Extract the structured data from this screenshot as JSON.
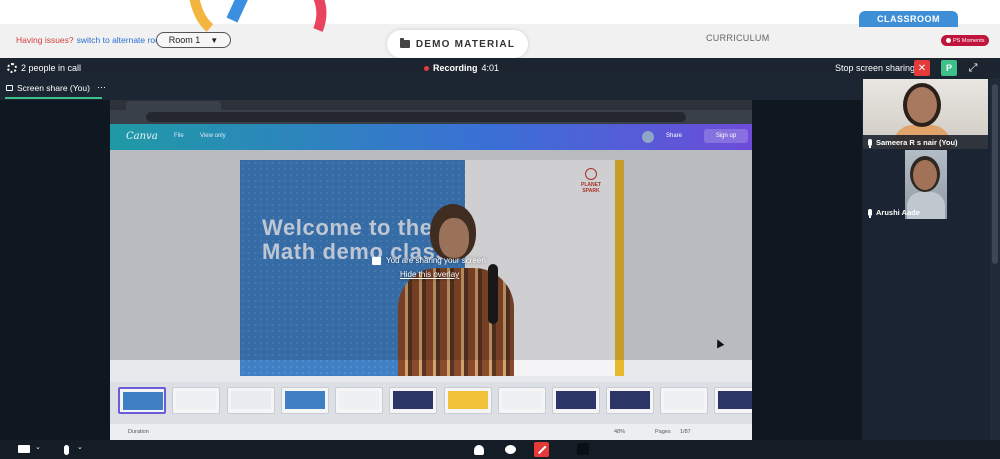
{
  "top": {
    "issue_text": "Having issues?",
    "issue_link": "switch to alternate room",
    "room_select": "Room 1",
    "demo_material": "DEMO MATERIAL",
    "curriculum": "CURRICULUM",
    "classroom": "CLASSROOM",
    "ps_moments": "PS Moments"
  },
  "call_bar": {
    "people": "2 people in call",
    "recording_label": "Recording",
    "recording_time": "4:01",
    "stop_sharing": "Stop screen sharing",
    "avatar_letter": "P"
  },
  "sub_tab": {
    "label": "Screen share (You)",
    "more": "⋯"
  },
  "shared_screen": {
    "slide_title": "Welcome to the Math demo class",
    "planet_logo": "PLANET SPARK",
    "overlay_message": "You are sharing your screen",
    "overlay_hide": "Hide this overlay",
    "canva_logo": "Canva",
    "canva_file": "File",
    "canva_view": "View only",
    "canva_share": "Share",
    "canva_signup": "Sign up",
    "duration": "Duration",
    "zoom": "48%",
    "pages": "Pages",
    "page_count": "1/87"
  },
  "participants": [
    {
      "name": "Sameera R s nair (You)"
    },
    {
      "name": "Arushi Aade"
    }
  ],
  "colors": {
    "accent_green": "#3fbf8a",
    "stop_red": "#e53a3a",
    "classroom_blue": "#3e8fd6",
    "dark_bg": "#0f1720"
  }
}
